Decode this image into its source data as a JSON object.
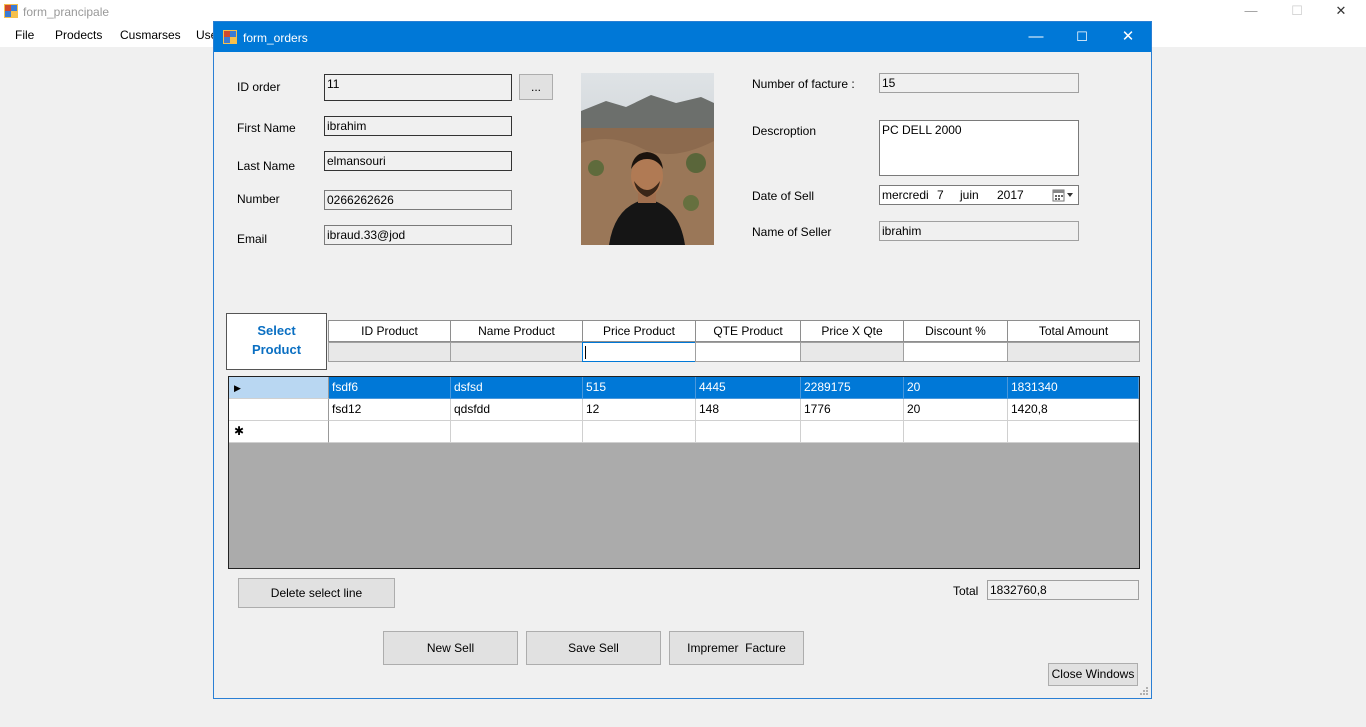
{
  "main_window": {
    "title": "form_prancipale",
    "minimize_glyph": "—",
    "maximize_glyph": "☐",
    "close_glyph": "✕",
    "menu": [
      "File",
      "Prodects",
      "Cusmarses",
      "Use"
    ]
  },
  "dialog": {
    "title": "form_orders",
    "minimize_glyph": "—",
    "maximize_glyph": "☐",
    "close_glyph": "✕"
  },
  "customer": {
    "id_order_label": "ID order",
    "id_order_value": "11",
    "browse_label": "...",
    "first_name_label": "First Name",
    "first_name_value": "ibrahim",
    "last_name_label": "Last Name",
    "last_name_value": "elmansouri",
    "number_label": "Number",
    "number_value": "0266262626",
    "email_label": "Email",
    "email_value": "ibraud.33@jod"
  },
  "invoice": {
    "facture_label": "Number of facture :",
    "facture_value": "15",
    "description_label": "Descroption",
    "description_value": "PC DELL 2000",
    "date_label": "Date of Sell",
    "date_day_name": "mercredi",
    "date_day": "7",
    "date_month": "juin",
    "date_year": "2017",
    "seller_label": "Name of Seller",
    "seller_value": "ibrahim"
  },
  "product_entry": {
    "select_label_1": "Select",
    "select_label_2": "Product",
    "columns": [
      "ID Product",
      "Name Product",
      "Price Product",
      "QTE Product",
      "Price X Qte",
      "Discount %",
      "Total Amount"
    ]
  },
  "grid": {
    "row_marker_selected": "▶",
    "row_marker_new": "✱",
    "rows": [
      [
        "fsdf6",
        "dsfsd",
        "515",
        "4445",
        "2289175",
        "20",
        "1831340"
      ],
      [
        "fsd12",
        "qdsfdd",
        "12",
        "148",
        "1776",
        "20",
        "1420,8"
      ]
    ]
  },
  "footer": {
    "delete_label": "Delete select line",
    "total_label": "Total",
    "total_value": "1832760,8",
    "new_sell_label": "New Sell",
    "save_sell_label": "Save Sell",
    "print_label": "Impremer  Facture",
    "close_label": "Close Windows"
  },
  "colors": {
    "accent": "#0078d7",
    "window_bg": "#f0f0f0",
    "grid_bg": "#ababab",
    "select_product_text": "#0a6fc2"
  }
}
